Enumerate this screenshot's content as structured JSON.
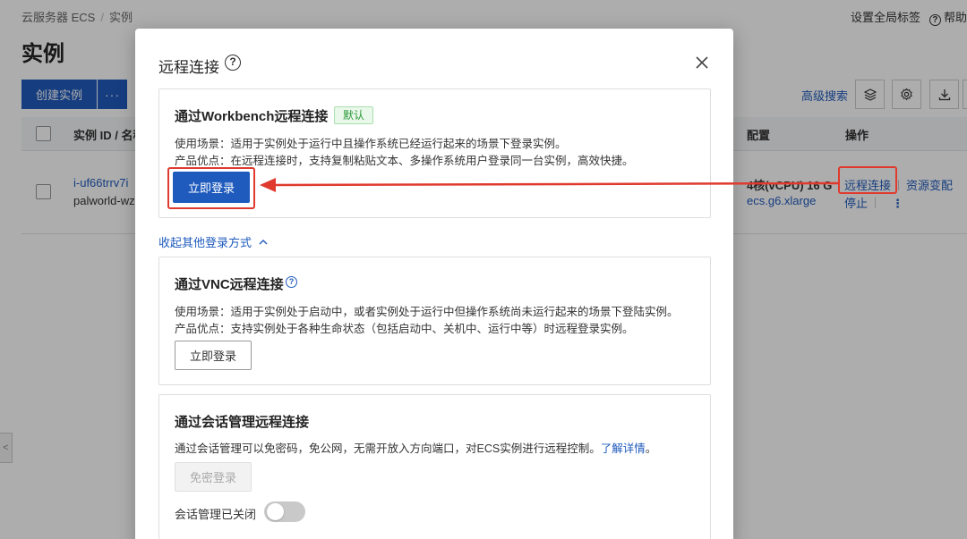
{
  "breadcrumb": {
    "items": [
      "云服务器 ECS",
      "实例"
    ],
    "separator": "/"
  },
  "header": {
    "tag_settings": "设置全局标签",
    "help": "帮助"
  },
  "page": {
    "title": "实例"
  },
  "toolbar": {
    "create_label": "创建实例",
    "more_label": "···",
    "advanced_search": "高级搜索"
  },
  "table": {
    "headers": {
      "id_name": "实例 ID / 名称",
      "config": "配置",
      "actions": "操作"
    },
    "row": {
      "id": "i-uf66trrv7i",
      "name": "palworld-wz",
      "config_line1": "4核(vCPU)  16 G",
      "config_line2": "ecs.g6.xlarge",
      "action_remote": "远程连接",
      "action_resize": "资源变配",
      "action_stop": "停止",
      "action_more": "⋮"
    }
  },
  "modal": {
    "title": "远程连接",
    "workbench": {
      "title": "通过Workbench远程连接",
      "badge": "默认",
      "usage": "使用场景：适用于实例处于运行中且操作系统已经运行起来的场景下登录实例。",
      "advantage": "产品优点：在远程连接时，支持复制粘贴文本、多操作系统用户登录同一台实例，高效快捷。",
      "login_button": "立即登录"
    },
    "collapse_label": "收起其他登录方式",
    "vnc": {
      "title": "通过VNC远程连接",
      "usage": "使用场景：适用于实例处于启动中，或者实例处于运行中但操作系统尚未运行起来的场景下登陆实例。",
      "advantage": "产品优点：支持实例处于各种生命状态（包括启动中、关机中、运行中等）时远程登录实例。",
      "login_button": "立即登录"
    },
    "session": {
      "title": "通过会话管理远程连接",
      "desc": "通过会话管理可以免密码，免公网，无需开放入方向端口，对ECS实例进行远程控制。",
      "learn_more": "了解详情",
      "desc_end": "。",
      "passwordless_button": "免密登录",
      "toggle_label": "会话管理已关闭",
      "toggle_on": false
    }
  },
  "colors": {
    "primary": "#1f5bbd",
    "highlight": "#e03a2e",
    "badge_bg": "#e9f8ea",
    "badge_text": "#2b9a3a"
  }
}
